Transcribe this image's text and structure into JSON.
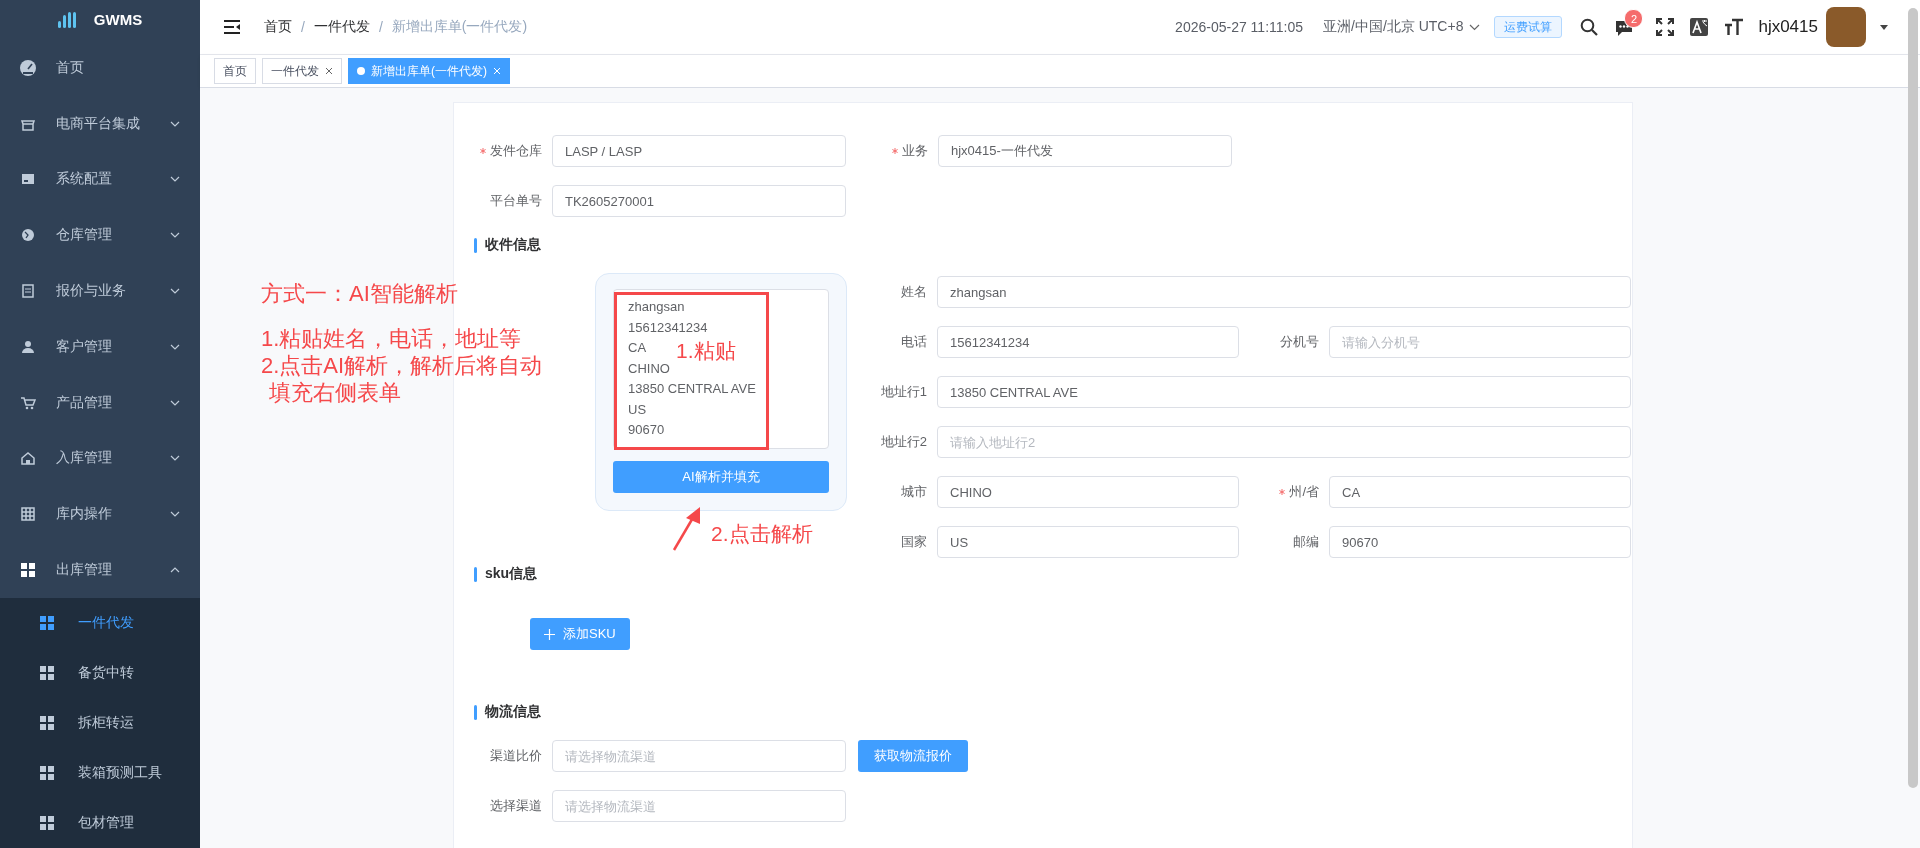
{
  "sidebar": {
    "logo": "GWMS",
    "items": [
      {
        "label": "首页",
        "expandable": false
      },
      {
        "label": "电商平台集成",
        "expandable": true,
        "expanded": false
      },
      {
        "label": "系统配置",
        "expandable": true,
        "expanded": false
      },
      {
        "label": "仓库管理",
        "expandable": true,
        "expanded": false
      },
      {
        "label": "报价与业务",
        "expandable": true,
        "expanded": false
      },
      {
        "label": "客户管理",
        "expandable": true,
        "expanded": false
      },
      {
        "label": "产品管理",
        "expandable": true,
        "expanded": false
      },
      {
        "label": "入库管理",
        "expandable": true,
        "expanded": false
      },
      {
        "label": "库内操作",
        "expandable": true,
        "expanded": false
      },
      {
        "label": "出库管理",
        "expandable": true,
        "expanded": true,
        "children": [
          {
            "label": "一件代发",
            "selected": true
          },
          {
            "label": "备货中转",
            "selected": false
          },
          {
            "label": "拆柜转运",
            "selected": false
          },
          {
            "label": "装箱预测工具",
            "selected": false
          },
          {
            "label": "包材管理",
            "selected": false
          }
        ]
      }
    ]
  },
  "header": {
    "breadcrumb": [
      "首页",
      "一件代发",
      "新增出库单(一件代发)"
    ],
    "breadcrumb_separators": [
      "/",
      "/"
    ],
    "datetime": "2026-05-27 11:11:05",
    "timezone": "亚洲/中国/北京 UTC+8",
    "freight_button": "运费试算",
    "message_badge": "2",
    "username": "hjx0415"
  },
  "tabs": [
    {
      "label": "首页",
      "selected": false,
      "closable": false
    },
    {
      "label": "一件代发",
      "selected": false,
      "closable": true
    },
    {
      "label": "新增出库单(一件代发)",
      "selected": true,
      "closable": true
    }
  ],
  "order_fields": [
    [
      {
        "label": "发件仓库",
        "required": true,
        "value": "LASP / LASP"
      },
      {
        "label": "业务",
        "required": true,
        "value": "hjx0415-一件代发"
      }
    ],
    [
      {
        "label": "平台单号",
        "required": false,
        "value": "TK2605270001"
      }
    ]
  ],
  "recipient": {
    "title": "收件信息",
    "paste_text": "zhangsan\n15612341234\nCA\nCHINO\n13850 CENTRAL AVE\nUS\n90670",
    "parse_button": "AI解析并填充",
    "fields": [
      [
        {
          "label": "姓名",
          "required": false,
          "value": "zhangsan"
        }
      ],
      [
        {
          "label": "电话",
          "required": false,
          "value": "15612341234"
        },
        {
          "label": "分机号",
          "required": false,
          "placeholder": "请输入分机号"
        }
      ],
      [
        {
          "label": "地址行1",
          "required": false,
          "value": "13850 CENTRAL AVE"
        }
      ],
      [
        {
          "label": "地址行2",
          "required": false,
          "placeholder": "请输入地址行2"
        }
      ],
      [
        {
          "label": "城市",
          "required": false,
          "value": "CHINO"
        },
        {
          "label": "州/省",
          "required": true,
          "value": "CA"
        }
      ],
      [
        {
          "label": "国家",
          "required": false,
          "value": "US"
        },
        {
          "label": "邮编",
          "required": false,
          "value": "90670"
        }
      ]
    ]
  },
  "sku": {
    "title": "sku信息",
    "add_button": "添加SKU"
  },
  "logistics": {
    "title": "物流信息",
    "fields": [
      {
        "label": "渠道比价",
        "placeholder": "请选择物流渠道",
        "button": "获取物流报价"
      },
      {
        "label": "选择渠道",
        "placeholder": "请选择物流渠道"
      }
    ]
  },
  "annotations": {
    "heading": "方式一：AI智能解析",
    "steps": [
      "1.粘贴姓名，电话，地址等",
      "2.点击AI解析，解析后将自动填充右侧表单"
    ],
    "paste_label": "1.粘贴",
    "click_label": "2.点击解析"
  }
}
